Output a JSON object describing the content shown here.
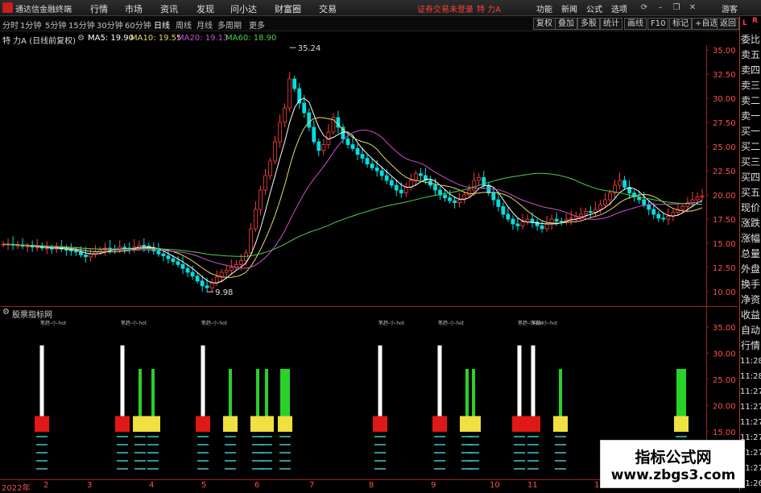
{
  "app": {
    "name": "通达信金融终端",
    "login_warning": "证券交易未登录",
    "stock": "特 力A",
    "guest": "游客"
  },
  "menu": [
    "行情",
    "市场",
    "资讯",
    "发现",
    "问小达",
    "财富圈",
    "交易"
  ],
  "right_menu": [
    "功能",
    "新闻",
    "公式",
    "选项"
  ],
  "periods": [
    "分时",
    "1分钟",
    "5分钟",
    "15分钟",
    "30分钟",
    "60分钟",
    "日线",
    "周线",
    "月线",
    "多周期",
    "更多"
  ],
  "active_period": "日线",
  "toolbar_buttons": [
    "复权",
    "叠加",
    "多股",
    "统计",
    "画线",
    "F10",
    "标记",
    "+自选",
    "返回"
  ],
  "corner": {
    "l": "L",
    "r": "R"
  },
  "info": {
    "title": "特 力A (日线前复权)",
    "ma5": "MA5: 19.90",
    "ma10": "MA10: 19.55",
    "ma20": "MA20: 19.13",
    "ma60": "MA60: 18.90"
  },
  "colors": {
    "up": "#ff3c3c",
    "down": "#00e0e0",
    "ma5": "#ffffff",
    "ma10": "#e8d86a",
    "ma20": "#d050d0",
    "ma60": "#4ecf4e"
  },
  "right_panel": [
    "委比",
    "卖五",
    "卖四",
    "卖三",
    "卖二",
    "卖一",
    "买一",
    "买二",
    "买三",
    "买四",
    "买五",
    "现价",
    "涨跌",
    "涨幅",
    "总量",
    "外盘",
    "换手",
    "净资",
    "收益",
    "自动",
    "行情",
    "11:28",
    "11:28",
    "11:27",
    "11:27",
    "11:27",
    "11:27",
    "11:27",
    "11:27",
    "11:26"
  ],
  "subchart_title": "股票指标网",
  "sub_label": "笔趋-小-hot",
  "watermark": {
    "line1": "指标公式网",
    "line2": "www.zbgs3.com"
  },
  "dates": [
    "2022年",
    "2",
    "3",
    "4",
    "5",
    "6",
    "7",
    "8",
    "9",
    "10",
    "11",
    "12"
  ],
  "chart_data": {
    "type": "candlestick",
    "y_axis": [
      35.0,
      32.5,
      30.0,
      27.5,
      25.0,
      22.5,
      20.0,
      17.5,
      15.0,
      12.5,
      10.0
    ],
    "annotations": [
      {
        "label": "35.24",
        "value": 35.24
      },
      {
        "label": "9.98",
        "value": 9.98
      }
    ],
    "sub_y_axis": [
      35.0,
      30.0,
      25.0,
      20.0,
      15.0
    ],
    "close": [
      14.9,
      14.9,
      14.8,
      14.8,
      14.7,
      14.7,
      14.6,
      14.6,
      14.5,
      14.5,
      14.4,
      14.5,
      14.4,
      14.3,
      14.2,
      14.1,
      13.8,
      13.6,
      13.9,
      14.1,
      14.3,
      14.5,
      14.4,
      14.3,
      14.6,
      14.5,
      14.4,
      14.6,
      14.8,
      14.7,
      14.5,
      14.2,
      13.9,
      13.7,
      13.4,
      13.1,
      12.8,
      12.4,
      12.0,
      11.6,
      11.1,
      10.6,
      10.4,
      10.9,
      11.5,
      12.0,
      12.2,
      12.5,
      12.8,
      13.2,
      14.0,
      16.5,
      18.5,
      20.5,
      22.0,
      23.5,
      25.5,
      27.5,
      29.0,
      32.0,
      31.0,
      29.5,
      28.5,
      27.0,
      25.5,
      24.6,
      25.2,
      26.5,
      28.0,
      27.0,
      25.8,
      25.2,
      24.8,
      24.2,
      23.8,
      23.2,
      22.8,
      22.5,
      22.0,
      21.5,
      21.0,
      20.5,
      20.2,
      20.8,
      21.5,
      22.2,
      22.0,
      21.5,
      21.0,
      20.5,
      20.0,
      19.7,
      19.4,
      19.2,
      19.5,
      20.0,
      20.5,
      21.5,
      21.8,
      21.0,
      20.2,
      19.5,
      18.8,
      18.0,
      17.5,
      17.0,
      16.8,
      17.2,
      17.5,
      17.2,
      16.8,
      16.5,
      17.0,
      17.5,
      17.3,
      17.2,
      17.5,
      17.6,
      17.8,
      18.0,
      18.3,
      18.2,
      18.5,
      19.0,
      19.5,
      20.2,
      21.0,
      21.5,
      20.8,
      20.2,
      19.8,
      19.5,
      19.0,
      18.5,
      18.0,
      17.6,
      17.5,
      17.8,
      18.2,
      18.5,
      18.8,
      19.2,
      19.5,
      19.8,
      19.9
    ]
  }
}
